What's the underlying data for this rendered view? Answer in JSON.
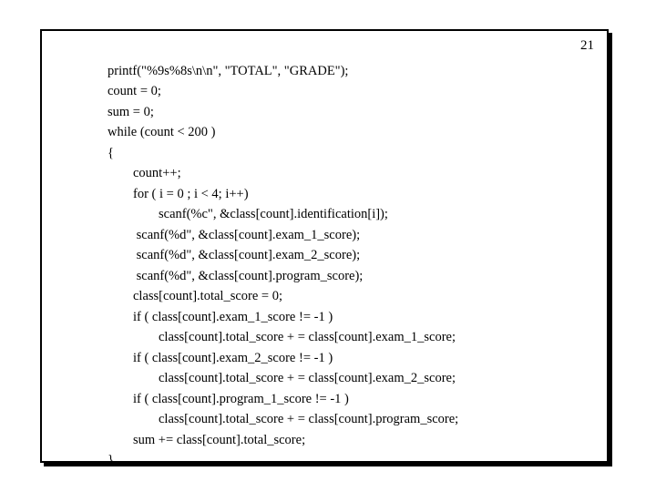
{
  "page_number": "21",
  "code": {
    "l1": "printf(\"%9s%8s\\n\\n\", \"TOTAL\", \"GRADE\");",
    "l2": "count = 0;",
    "l3": "sum = 0;",
    "l4": "while (count < 200 )",
    "l5": "{",
    "l6": "count++;",
    "l7": "for ( i = 0 ; i < 4; i++)",
    "l8": "scanf(%c\", &class[count].identification[i]);",
    "l9": " scanf(%d\", &class[count].exam_1_score);",
    "l10": " scanf(%d\", &class[count].exam_2_score);",
    "l11": " scanf(%d\", &class[count].program_score);",
    "l12": "class[count].total_score = 0;",
    "l13": "if ( class[count].exam_1_score != -1 )",
    "l14": "class[count].total_score + = class[count].exam_1_score;",
    "l15": "if ( class[count].exam_2_score != -1 )",
    "l16": "class[count].total_score + = class[count].exam_2_score;",
    "l17": "if ( class[count].program_1_score != -1 )",
    "l18": "class[count].total_score + = class[count].program_score;",
    "l19": "sum += class[count].total_score;",
    "l20": "}"
  }
}
